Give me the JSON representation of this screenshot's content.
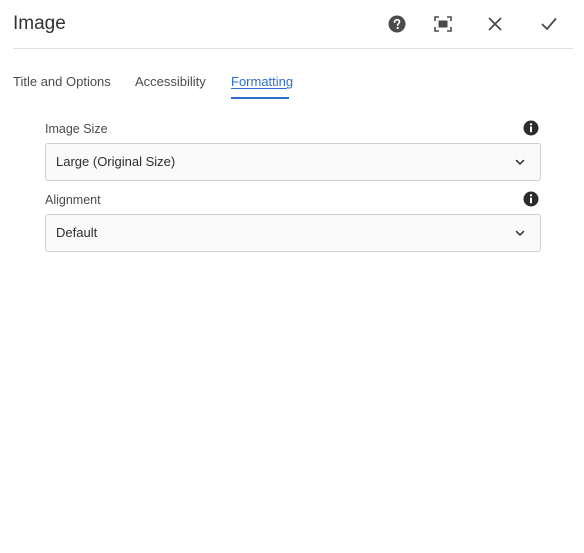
{
  "dialog": {
    "title": "Image",
    "actions": {
      "help": "help-icon",
      "fullscreen": "fullscreen-icon",
      "close": "close-icon",
      "done": "checkmark-icon"
    }
  },
  "tabs": [
    {
      "label": "Title and Options",
      "selected": false
    },
    {
      "label": "Accessibility",
      "selected": false
    },
    {
      "label": "Formatting",
      "selected": true
    }
  ],
  "fields": {
    "image_size": {
      "label": "Image Size",
      "value": "Large (Original Size)"
    },
    "alignment": {
      "label": "Alignment",
      "value": "Default"
    }
  },
  "colors": {
    "accent": "#2d6ecf",
    "icon": "#4b4b4b",
    "border": "#cfcfcf"
  }
}
